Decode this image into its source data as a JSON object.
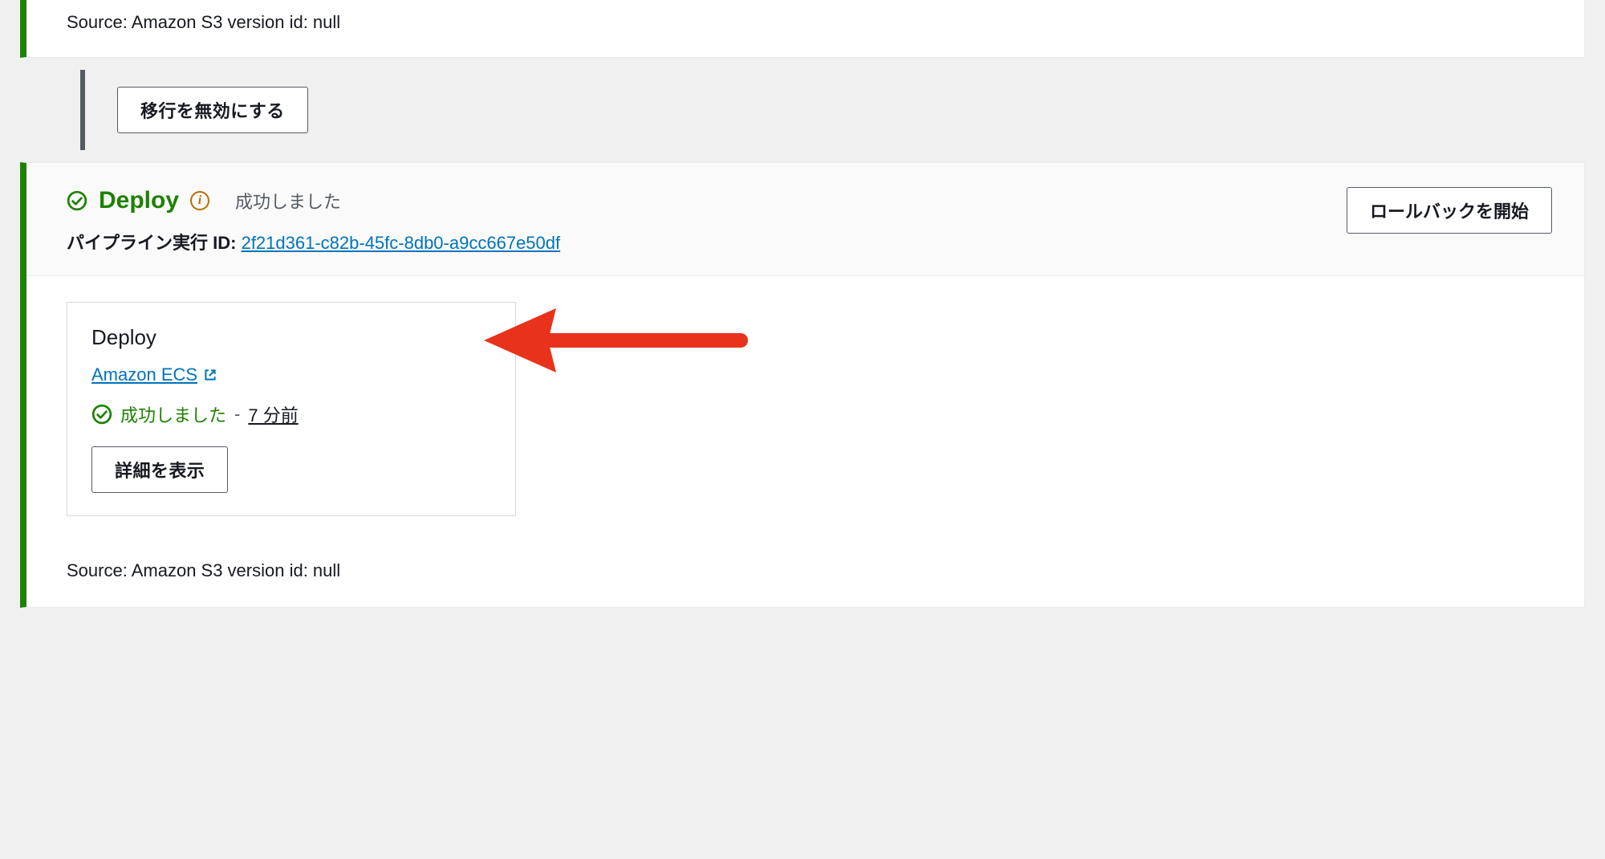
{
  "source_stage": {
    "footer_text": "Source: Amazon S3 version id: null"
  },
  "transition": {
    "disable_button": "移行を無効にする"
  },
  "deploy_stage": {
    "title": "Deploy",
    "status": "成功しました",
    "pipeline_label": "パイプライン実行 ID:",
    "pipeline_id": "2f21d361-c82b-45fc-8db0-a9cc667e50df",
    "rollback_button": "ロールバックを開始",
    "action": {
      "name": "Deploy",
      "provider": "Amazon ECS",
      "status": "成功しました",
      "time_ago": "7 分前",
      "details_button": "詳細を表示"
    },
    "footer_text": "Source: Amazon S3 version id: null"
  }
}
